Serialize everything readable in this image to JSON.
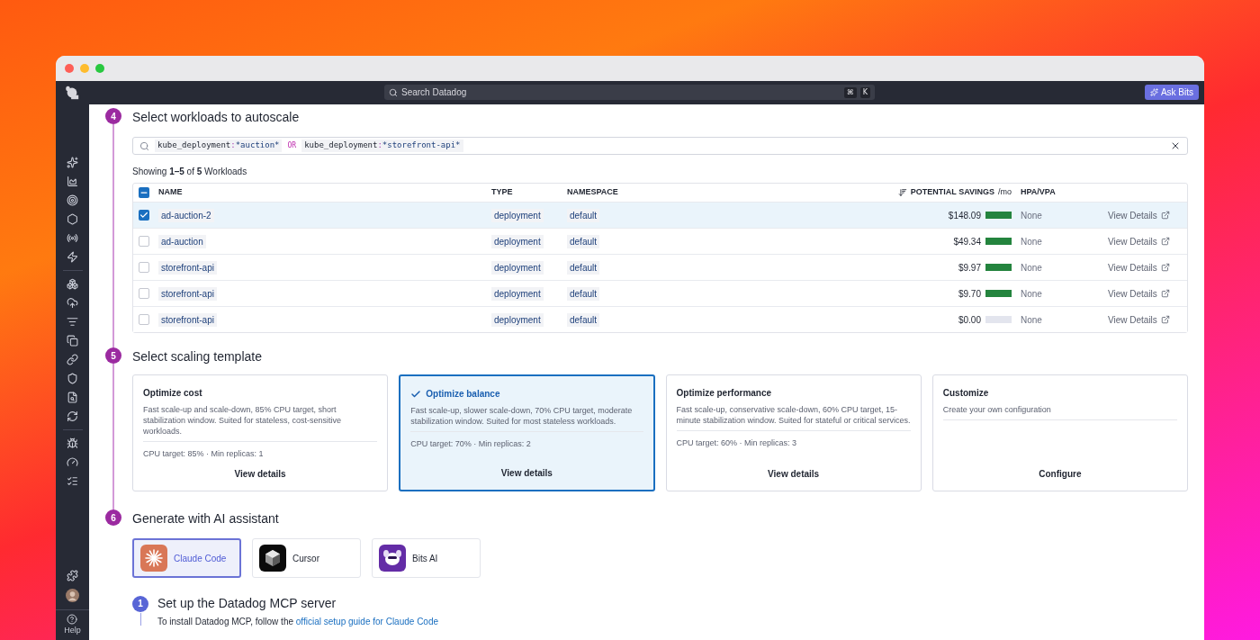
{
  "top_bar": {
    "search": {
      "placeholder": "Search Datadog"
    },
    "shortcut": [
      "⌘",
      "K"
    ],
    "ask_button": "Ask Bits"
  },
  "sidebar": {
    "help": "Help"
  },
  "workloads_step": {
    "number": "4",
    "title": "Select workloads to autoscale",
    "query": [
      {
        "kind": "term",
        "key": "kube_deployment",
        "separator": ":",
        "value": "*auction*"
      },
      {
        "kind": "operator",
        "text": "OR"
      },
      {
        "kind": "term",
        "key": "kube_deployment",
        "separator": ":",
        "value": "*storefront-api*"
      }
    ],
    "summary": "Showing **1–5** of **5** Workloads",
    "table": {
      "partially_selected": true,
      "columns": [
        {
          "label": "NAME",
          "sorted": false
        },
        {
          "label": "TYPE",
          "sorted": false
        },
        {
          "label": "NAMESPACE",
          "sorted": false
        },
        {
          "label": "POTENTIAL SAVINGS",
          "unit": "/mo",
          "sorted": true
        },
        {
          "label": "HPA/VPA",
          "sorted": false
        }
      ],
      "rows": [
        {
          "selected": true,
          "name": "ad-auction-2",
          "type": "deployment",
          "namespace": "default",
          "savings": "$148.09",
          "level": 1,
          "hpa_vpa": "None",
          "action": "View Details"
        },
        {
          "selected": false,
          "name": "ad-auction",
          "type": "deployment",
          "namespace": "default",
          "savings": "$49.34",
          "level": 1,
          "hpa_vpa": "None",
          "action": "View Details"
        },
        {
          "selected": false,
          "name": "storefront-api",
          "type": "deployment",
          "namespace": "default",
          "savings": "$9.97",
          "level": 1,
          "hpa_vpa": "None",
          "action": "View Details"
        },
        {
          "selected": false,
          "name": "storefront-api",
          "type": "deployment",
          "namespace": "default",
          "savings": "$9.70",
          "level": 1,
          "hpa_vpa": "None",
          "action": "View Details"
        },
        {
          "selected": false,
          "name": "storefront-api",
          "type": "deployment",
          "namespace": "default",
          "savings": "$0.00",
          "level": 0,
          "hpa_vpa": "None",
          "action": "View Details"
        }
      ]
    }
  },
  "template_step": {
    "number": "5",
    "title": "Select scaling template",
    "templates": [
      {
        "selected": false,
        "title": "Optimize cost",
        "description": "Fast scale-up and scale-down, 85% CPU target, short stabilization window. Suited for stateless, cost-sensitive workloads.",
        "summary": "CPU target: 85% · Min replicas: 1",
        "action": "View details"
      },
      {
        "selected": true,
        "title": "Optimize balance",
        "description": "Fast scale-up, slower scale-down, 70% CPU target, moderate stabilization window. Suited for most stateless workloads.",
        "summary": "CPU target: 70% · Min replicas: 2",
        "action": "View details"
      },
      {
        "selected": false,
        "title": "Optimize performance",
        "description": "Fast scale-up, conservative scale-down, 60% CPU target, 15-minute stabilization window. Suited for stateful or critical services.",
        "summary": "CPU target: 60% · Min replicas: 3",
        "action": "View details"
      },
      {
        "selected": false,
        "title": "Customize",
        "description": "Create your own configuration",
        "action": "Configure"
      }
    ]
  },
  "assistant_step": {
    "number": "6",
    "title": "Generate with AI assistant",
    "assistants": [
      {
        "kind": "claude",
        "name": "Claude Code",
        "selected": true
      },
      {
        "kind": "cursor",
        "name": "Cursor",
        "selected": false
      },
      {
        "kind": "bits",
        "name": "Bits AI",
        "selected": false
      }
    ],
    "substep": {
      "number": "1",
      "title": "Set up the Datadog MCP server",
      "text": "To install Datadog MCP, follow the ",
      "link": "official setup guide for Claude Code"
    }
  }
}
